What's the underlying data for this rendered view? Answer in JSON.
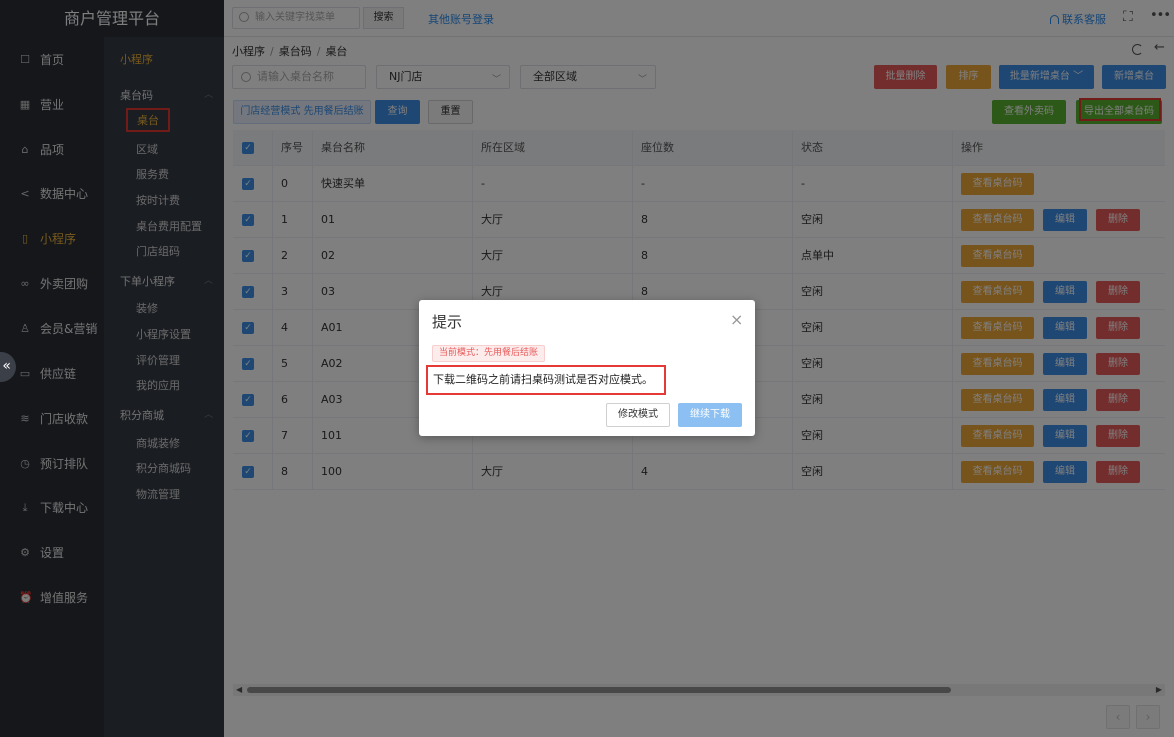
{
  "brand": "商户管理平台",
  "topbar": {
    "search_placeholder": "输入关键字找菜单",
    "search_button": "搜索",
    "other_login": "其他账号登录",
    "service": "联系客服",
    "fullscreen_icon": "fullscreen-icon",
    "more_icon": "more-icon"
  },
  "sidebar": {
    "items": [
      {
        "label": "首页",
        "icon": "home-icon"
      },
      {
        "label": "营业",
        "icon": "calendar-icon"
      },
      {
        "label": "品项",
        "icon": "bag-icon"
      },
      {
        "label": "数据中心",
        "icon": "share-icon"
      },
      {
        "label": "小程序",
        "icon": "phone-icon"
      },
      {
        "label": "外卖团购",
        "icon": "bike-icon"
      },
      {
        "label": "会员&营销",
        "icon": "user-icon"
      },
      {
        "label": "供应链",
        "icon": "truck-icon"
      },
      {
        "label": "门店收款",
        "icon": "coins-icon"
      },
      {
        "label": "预订排队",
        "icon": "clock-icon"
      },
      {
        "label": "下载中心",
        "icon": "download-icon"
      },
      {
        "label": "设置",
        "icon": "gear-icon"
      },
      {
        "label": "增值服务",
        "icon": "alarm-icon"
      }
    ],
    "active_index": 4
  },
  "subnav": {
    "header": "小程序",
    "groups": [
      {
        "title": "桌台码",
        "items": [
          "桌台",
          "区域",
          "服务费",
          "按时计费",
          "桌台费用配置",
          "门店组码"
        ]
      },
      {
        "title": "下单小程序",
        "items": [
          "装修",
          "小程序设置",
          "评价管理",
          "我的应用"
        ]
      },
      {
        "title": "积分商城",
        "items": [
          "商城装修",
          "积分商城码",
          "物流管理"
        ]
      }
    ]
  },
  "breadcrumb": [
    "小程序",
    "桌台码",
    "桌台"
  ],
  "filters": {
    "name_placeholder": "请输入桌台名称",
    "store": "NJ门店",
    "area": "全部区域",
    "mode_tag": "门店经营模式 先用餐后结账",
    "query": "查询",
    "reset": "重置"
  },
  "actions": {
    "batch_delete": "批量删除",
    "sort": "排序",
    "batch_add": "批量新增桌台",
    "add": "新增桌台",
    "view_takeout": "查看外卖码",
    "export_all": "导出全部桌台码"
  },
  "table": {
    "headers": [
      "序号",
      "桌台名称",
      "所在区域",
      "座位数",
      "状态",
      "操作"
    ],
    "rows": [
      {
        "no": "0",
        "name": "快速买单",
        "area": "-",
        "seats": "-",
        "status": "-",
        "ops": [
          "查看桌台码"
        ]
      },
      {
        "no": "1",
        "name": "01",
        "area": "大厅",
        "seats": "8",
        "status": "空闲",
        "ops": [
          "查看桌台码",
          "编辑",
          "删除"
        ]
      },
      {
        "no": "2",
        "name": "02",
        "area": "大厅",
        "seats": "8",
        "status": "点单中",
        "ops": [
          "查看桌台码"
        ]
      },
      {
        "no": "3",
        "name": "03",
        "area": "大厅",
        "seats": "8",
        "status": "空闲",
        "ops": [
          "查看桌台码",
          "编辑",
          "删除"
        ]
      },
      {
        "no": "4",
        "name": "A01",
        "area": "",
        "seats": "",
        "status": "空闲",
        "ops": [
          "查看桌台码",
          "编辑",
          "删除"
        ]
      },
      {
        "no": "5",
        "name": "A02",
        "area": "",
        "seats": "",
        "status": "空闲",
        "ops": [
          "查看桌台码",
          "编辑",
          "删除"
        ]
      },
      {
        "no": "6",
        "name": "A03",
        "area": "",
        "seats": "",
        "status": "空闲",
        "ops": [
          "查看桌台码",
          "编辑",
          "删除"
        ]
      },
      {
        "no": "7",
        "name": "101",
        "area": "",
        "seats": "",
        "status": "空闲",
        "ops": [
          "查看桌台码",
          "编辑",
          "删除"
        ]
      },
      {
        "no": "8",
        "name": "100",
        "area": "大厅",
        "seats": "4",
        "status": "空闲",
        "ops": [
          "查看桌台码",
          "编辑",
          "删除"
        ]
      }
    ]
  },
  "modal": {
    "title": "提示",
    "tag": "当前模式：先用餐后结账",
    "message": "下载二维码之前请扫桌码测试是否对应模式。",
    "cancel": "修改模式",
    "ok": "继续下载"
  },
  "colors": {
    "sidebar_bg": "#2b2f36",
    "accent_gold": "#f0b43c",
    "primary_blue": "#3d8ee8",
    "danger_red": "#e85b5b",
    "warning_orange": "#f0a93a",
    "success_green": "#59b32e",
    "highlight_red": "#e53935"
  }
}
